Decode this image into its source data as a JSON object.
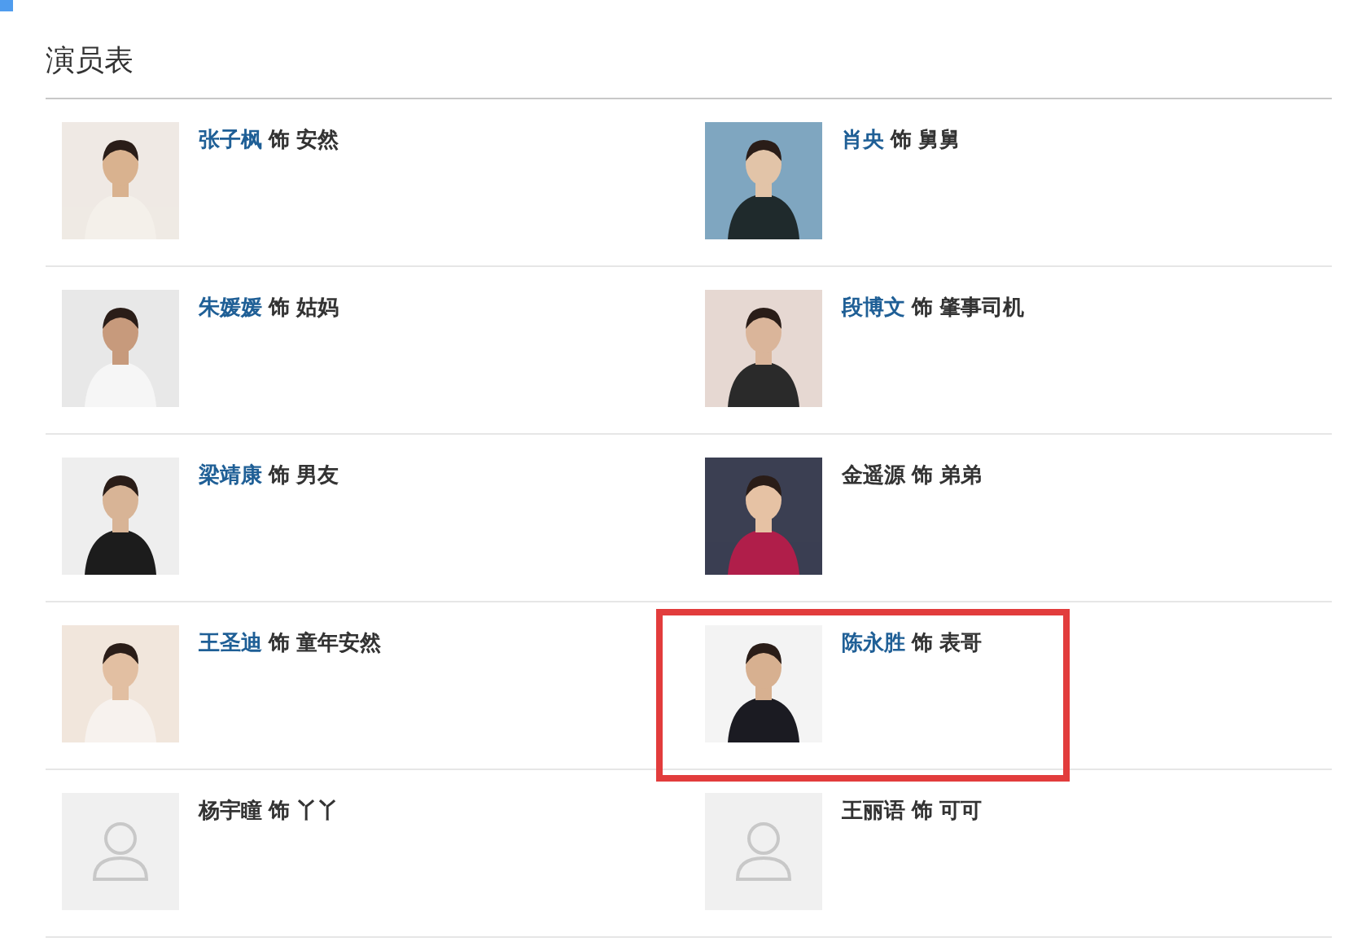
{
  "section_title": "演员表",
  "cast": [
    {
      "actor": "张子枫",
      "linked": true,
      "link_word": "饰",
      "role": "安然",
      "highlighted": false
    },
    {
      "actor": "肖央",
      "linked": true,
      "link_word": "饰",
      "role": "舅舅",
      "highlighted": false
    },
    {
      "actor": "朱媛媛",
      "linked": true,
      "link_word": "饰",
      "role": "姑妈",
      "highlighted": false
    },
    {
      "actor": "段博文",
      "linked": true,
      "link_word": "饰",
      "role": "肇事司机",
      "highlighted": false
    },
    {
      "actor": "梁靖康",
      "linked": true,
      "link_word": "饰",
      "role": "男友",
      "highlighted": false
    },
    {
      "actor": "金遥源",
      "linked": false,
      "link_word": "饰",
      "role": "弟弟",
      "highlighted": false
    },
    {
      "actor": "王圣迪",
      "linked": true,
      "link_word": "饰",
      "role": "童年安然",
      "highlighted": false
    },
    {
      "actor": "陈永胜",
      "linked": true,
      "link_word": "饰",
      "role": "表哥",
      "highlighted": true
    },
    {
      "actor": "杨宇瞳",
      "linked": false,
      "link_word": "饰",
      "role": "丫丫",
      "kind": "placeholder",
      "highlighted": false
    },
    {
      "actor": "王丽语",
      "linked": false,
      "link_word": "饰",
      "role": "可可",
      "kind": "placeholder",
      "highlighted": false
    }
  ]
}
